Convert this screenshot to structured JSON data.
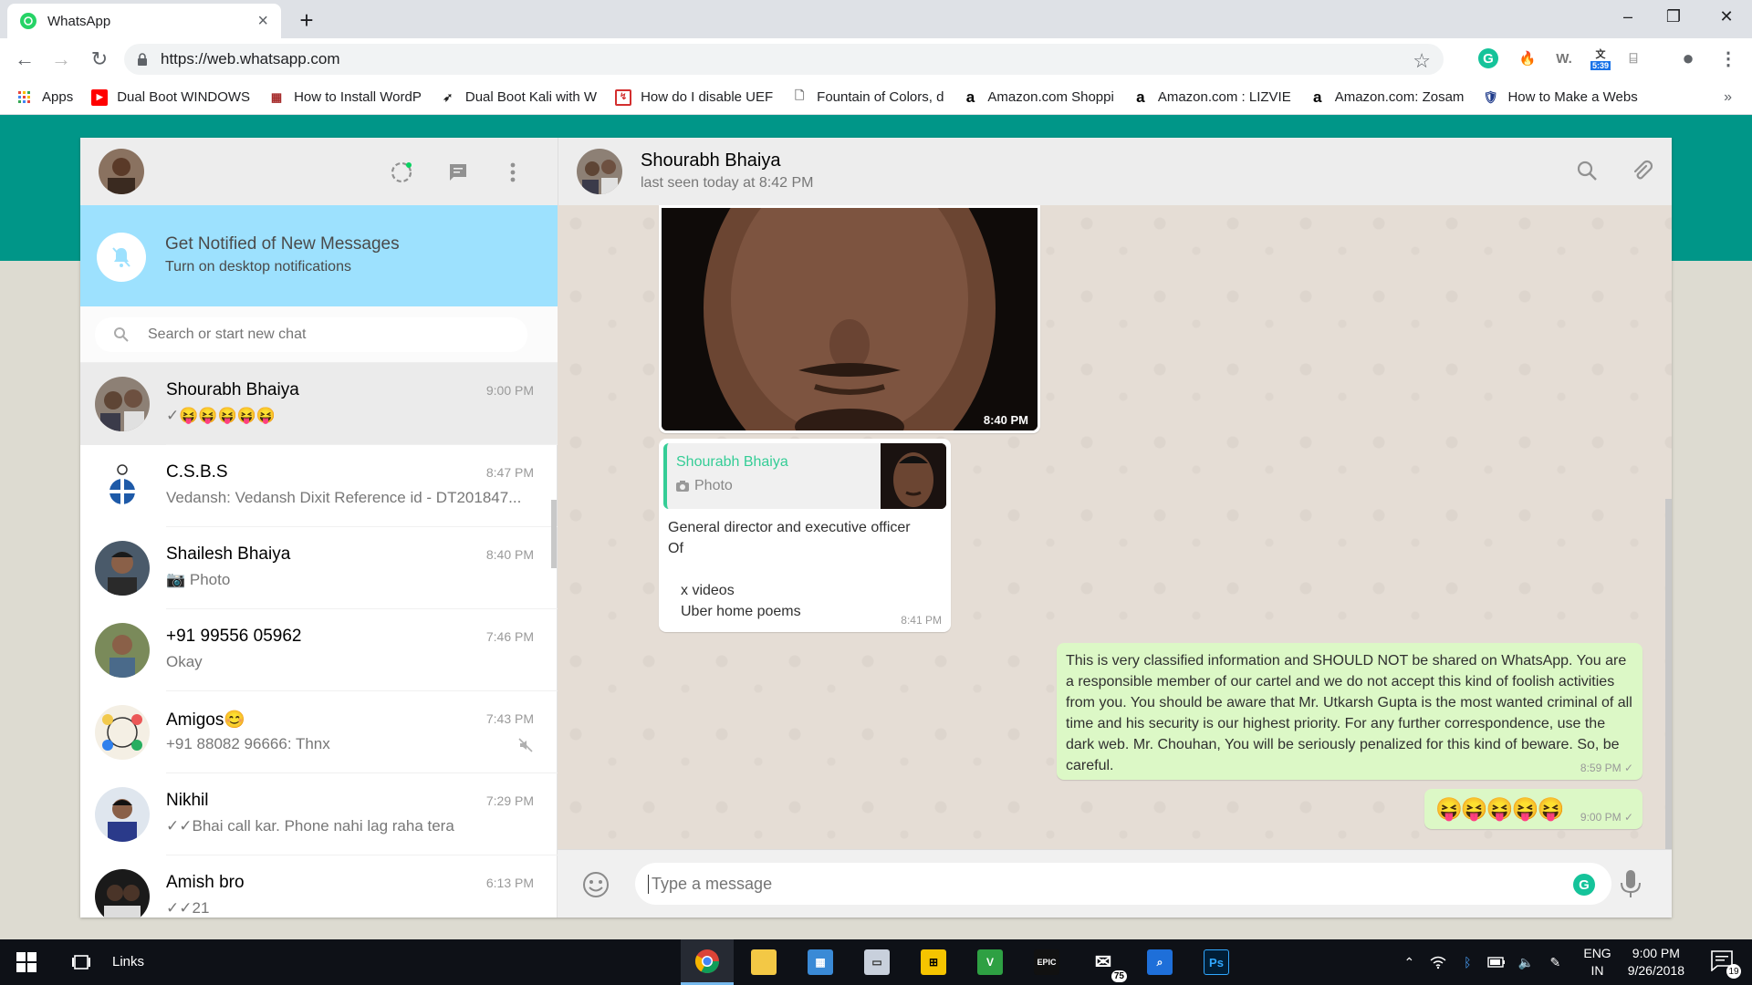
{
  "browser": {
    "tab_title": "WhatsApp",
    "url": "https://web.whatsapp.com",
    "extension_badge": "5:39",
    "bookmarks": [
      {
        "label": "Apps",
        "icon": "apps-grid-icon",
        "color": "#e8453c"
      },
      {
        "label": "Dual Boot WINDOWS",
        "icon": "youtube-icon",
        "color": "#ff0000"
      },
      {
        "label": "How to Install WordP",
        "icon": "site-icon",
        "color": "#a52a2a"
      },
      {
        "label": "Dual Boot Kali with W",
        "icon": "kali-dragon-icon",
        "color": "#222222"
      },
      {
        "label": "How do I disable UEF",
        "icon": "site-icon",
        "color": "#d32f2f"
      },
      {
        "label": "Fountain of Colors, d",
        "icon": "page-icon",
        "color": "#777777"
      },
      {
        "label": "Amazon.com Shoppi",
        "icon": "amazon-icon",
        "color": "#000000"
      },
      {
        "label": "Amazon.com : LIZVIE",
        "icon": "amazon-icon",
        "color": "#000000"
      },
      {
        "label": "Amazon.com: Zosam",
        "icon": "amazon-icon",
        "color": "#000000"
      },
      {
        "label": "How to Make a Webs",
        "icon": "shield-icon",
        "color": "#1e3a8a"
      }
    ]
  },
  "sidebar": {
    "notification": {
      "title": "Get Notified of New Messages",
      "subtitle": "Turn on desktop notifications"
    },
    "search_placeholder": "Search or start new chat",
    "chats": [
      {
        "name": "Shourabh Bhaiya",
        "time": "9:00 PM",
        "last": "✓😝😝😝😝😝",
        "active": true,
        "avatar_color": "#6b5a4e"
      },
      {
        "name": "C.S.B.S",
        "time": "8:47 PM",
        "last": "Vedansh: Vedansh Dixit Reference id - DT201847...",
        "active": false,
        "avatar_color": "#ffffff"
      },
      {
        "name": "Shailesh Bhaiya",
        "time": "8:40 PM",
        "last": "📷 Photo",
        "active": false,
        "avatar_color": "#4a5a6a"
      },
      {
        "name": "+91 99556 05962",
        "time": "7:46 PM",
        "last": "Okay",
        "active": false,
        "avatar_color": "#7a8a5a"
      },
      {
        "name": "Amigos😊",
        "time": "7:43 PM",
        "last": "+91 88082 96666: Thnx",
        "active": false,
        "avatar_color": "#e8e0d0",
        "muted": true
      },
      {
        "name": "Nikhil",
        "time": "7:29 PM",
        "last": "✓✓Bhai call kar. Phone nahi lag raha tera",
        "active": false,
        "avatar_color": "#2a3a6a"
      },
      {
        "name": "Amish bro",
        "time": "6:13 PM",
        "last": "✓✓21",
        "active": false,
        "avatar_color": "#1a1a1a"
      }
    ]
  },
  "conversation": {
    "contact_name": "Shourabh Bhaiya",
    "status": "last seen today at 8:42 PM",
    "photo_time": "8:40 PM",
    "reply": {
      "quoted_name": "Shourabh Bhaiya",
      "quoted_type": "Photo",
      "lines": [
        "General director and executive officer",
        "Of",
        "",
        "x videos",
        "Uber home poems"
      ],
      "time": "8:41 PM"
    },
    "long_message": {
      "text": "This is very classified information and SHOULD NOT be shared on WhatsApp. You are a responsible member of our cartel and we do not accept this kind of foolish activities from you. You should be aware that Mr. Utkarsh Gupta is the most wanted criminal of all time and his security is our highest priority. For any further correspondence, use the dark web. Mr. Chouhan, You will be seriously penalized for this kind of beware. So, be careful.",
      "time": "8:59 PM ✓"
    },
    "emoji_message": {
      "text": "😝😝😝😝😝",
      "time": "9:00 PM ✓"
    },
    "input_placeholder": "Type a message"
  },
  "taskbar": {
    "links_label": "Links",
    "mail_badge": "75",
    "lang_line1": "ENG",
    "lang_line2": "IN",
    "time": "9:00 PM",
    "date": "9/26/2018",
    "notification_count": "19"
  },
  "colors": {
    "whatsapp_teal": "#009688",
    "outgoing_bubble": "#dcf8c6",
    "notification_banner": "#9de1fe",
    "quote_accent": "#35cd96"
  }
}
